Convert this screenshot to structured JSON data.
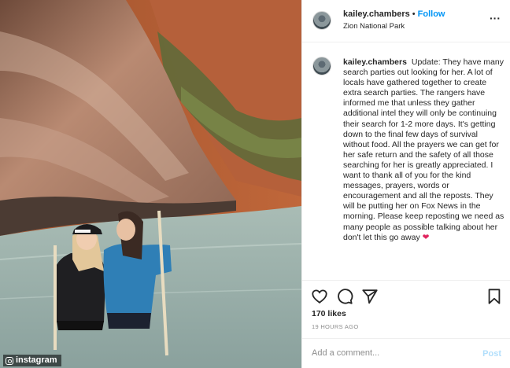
{
  "header": {
    "username": "kailey.chambers",
    "follow_label": "Follow",
    "location": "Zion National Park",
    "more_icon": "more-options-icon"
  },
  "caption": {
    "username": "kailey.chambers",
    "text": "Update: They have many search parties out looking for her. A lot of locals have gathered together to create extra search parties. The rangers have informed me that unless they gather additional intel they will only be continuing their search for 1-2 more days. It's getting down to the final few days of survival without food. All the prayers we can get for her safe return and the safety of all those searching for her is greatly appreciated. I want to thank all of you for the kind messages, prayers, words or encouragement and all the reposts. They will be putting her on Fox News in the morning. Please keep reposting we need as many people as possible talking about her don't let this go away",
    "emoji": "❤"
  },
  "actions": {
    "icons": [
      "heart-icon",
      "comment-icon",
      "share-icon",
      "bookmark-icon"
    ]
  },
  "likes": "170 likes",
  "timestamp": "19 HOURS AGO",
  "comment_box": {
    "placeholder": "Add a comment...",
    "post_label": "Post"
  },
  "watermark": "instagram",
  "colors": {
    "link_blue": "#0095f6",
    "post_disabled": "#b2dffc",
    "meta_gray": "#8e8e8e",
    "text": "#262626",
    "heart_red": "#e0245e"
  }
}
